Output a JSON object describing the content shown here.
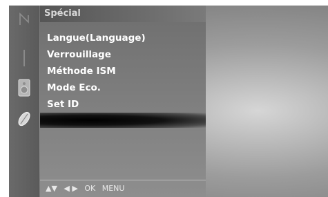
{
  "menu": {
    "title": "Spécial",
    "items": [
      {
        "label": "Langue(Language)"
      },
      {
        "label": "Verrouillage"
      },
      {
        "label": "Méthode ISM"
      },
      {
        "label": "Mode Eco."
      },
      {
        "label": "Set ID"
      }
    ]
  },
  "footer": {
    "nav_arrows_ud": "▲▼",
    "nav_arrows_lr": "◀ ▶",
    "ok_label": "OK",
    "menu_label": "MENU"
  },
  "sidebar": {
    "icons": [
      "antenna-icon",
      "bar-icon",
      "speaker-icon",
      "leaf-icon"
    ]
  }
}
